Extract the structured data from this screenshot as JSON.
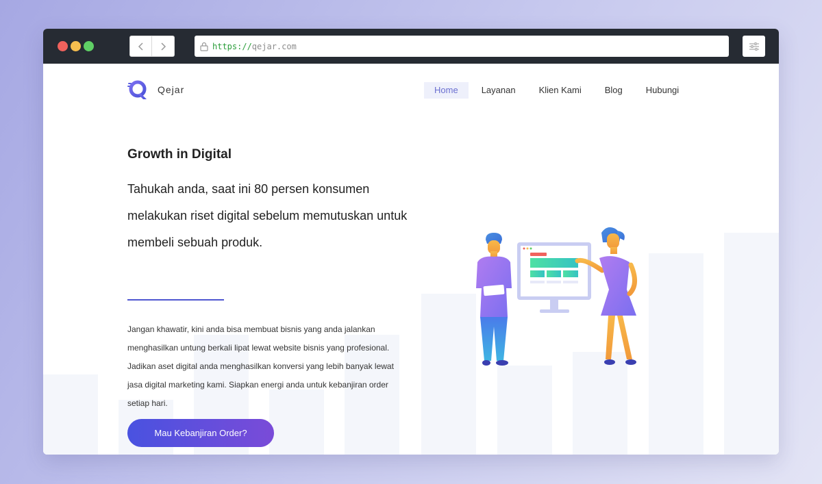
{
  "browser": {
    "url_scheme": "https://",
    "url_host": "qejar.com",
    "icons": {
      "back": "chevron-left-icon",
      "forward": "chevron-right-icon",
      "lock": "lock-icon",
      "settings": "sliders-icon"
    }
  },
  "site": {
    "logo_text": "Qejar",
    "logo_color": "#5b5fe0",
    "nav": [
      {
        "label": "Home",
        "active": true
      },
      {
        "label": "Layanan",
        "active": false
      },
      {
        "label": "Klien Kami",
        "active": false
      },
      {
        "label": "Blog",
        "active": false
      },
      {
        "label": "Hubungi",
        "active": false
      }
    ]
  },
  "hero": {
    "title": "Growth in Digital",
    "lead": "Tahukah anda, saat ini 80 persen konsumen melakukan riset digital sebelum memutuskan untuk membeli sebuah produk.",
    "body_line1": "Jangan khawatir, kini anda bisa membuat bisnis yang anda jalankan menghasilkan untung berkali lipat lewat website bisnis yang profesional.",
    "body_line2": "Jadikan aset digital anda menghasilkan konversi yang lebih banyak lewat jasa digital marketing kami. Siapkan energi anda untuk kebanjiran order setiap hari.",
    "cta_label": "Mau Kebanjiran Order?"
  },
  "colors": {
    "accent": "#4e56d1",
    "cta_start": "#4952e0",
    "cta_end": "#7a4bd8"
  }
}
